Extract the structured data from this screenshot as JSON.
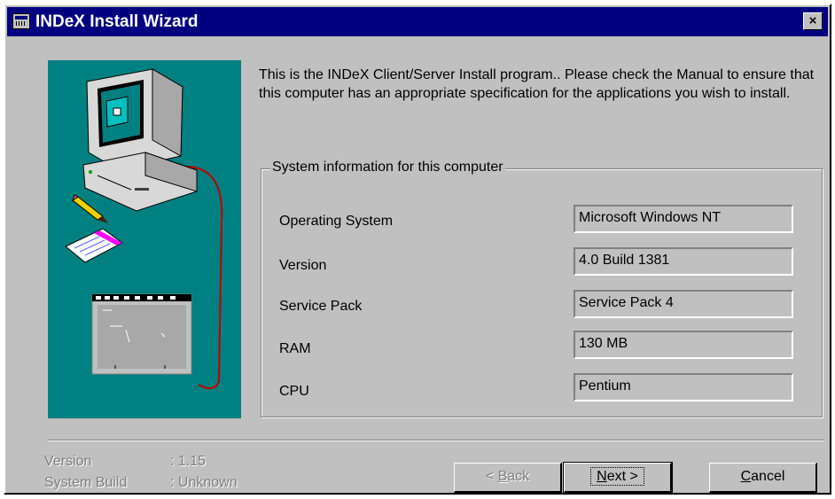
{
  "window": {
    "title": "INDeX Install Wizard",
    "close_label": "×"
  },
  "intro_text": "This is the INDeX Client/Server Install program.. Please check the Manual to ensure that this computer has an appropriate specification for the applications you wish to install.",
  "system_info": {
    "legend": "System information for this computer",
    "rows": [
      {
        "label": "Operating System",
        "value": "Microsoft Windows NT"
      },
      {
        "label": "Version",
        "value": "4.0 Build 1381"
      },
      {
        "label": "Service Pack",
        "value": "Service Pack 4"
      },
      {
        "label": "RAM",
        "value": "130 MB"
      },
      {
        "label": "CPU",
        "value": "Pentium"
      }
    ]
  },
  "footer": {
    "version_label": "Version",
    "version_value": ": 1.15",
    "build_label": "System Build",
    "build_value": ": Unknown"
  },
  "buttons": {
    "back_prefix": "< ",
    "back_mnemonic": "B",
    "back_rest": "ack",
    "next_mnemonic": "N",
    "next_rest": "ext >",
    "cancel_mnemonic": "C",
    "cancel_rest": "ancel"
  },
  "colors": {
    "title_bar": "#000080",
    "face": "#c0c0c0",
    "illustration_bg": "#008080"
  },
  "icons": [
    "app-icon",
    "close-icon",
    "computer-icon",
    "pencil-icon",
    "notepad-icon"
  ]
}
